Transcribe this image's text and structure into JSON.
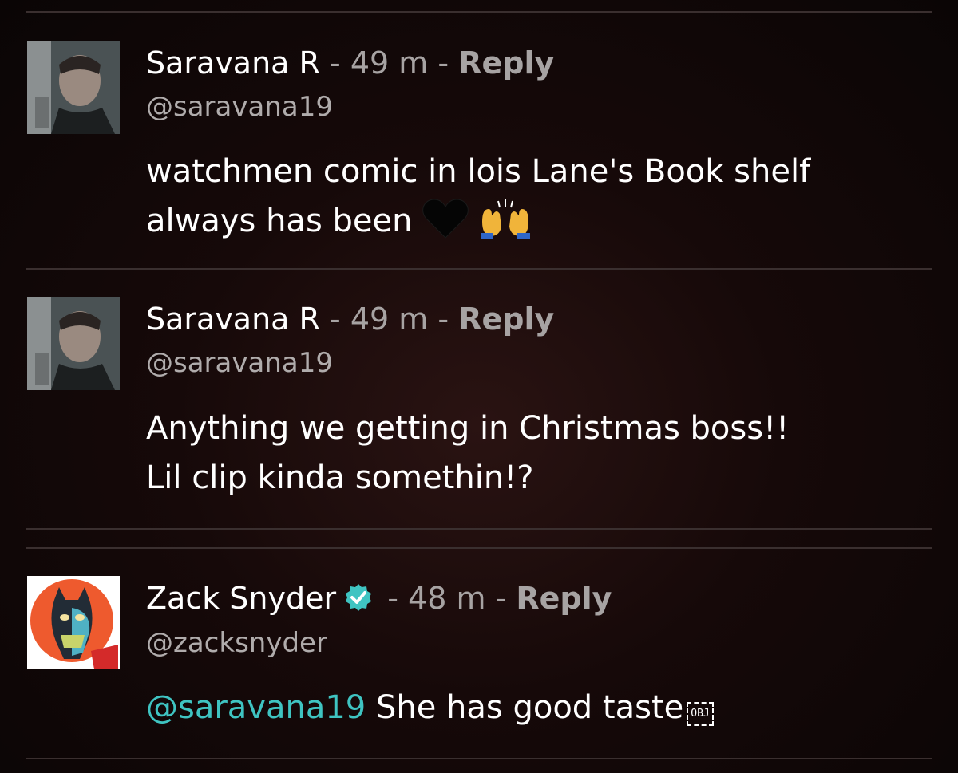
{
  "comments": [
    {
      "author": "Saravana R",
      "separator": "-",
      "time": "49 m",
      "reply_label": "Reply",
      "handle": "@saravana19",
      "text_line1": "watchmen comic in lois Lane's Book shelf",
      "text_line2": "always has been",
      "emojis": [
        "black-heart",
        "raising-hands"
      ]
    },
    {
      "author": "Saravana R",
      "separator": "-",
      "time": "49 m",
      "reply_label": "Reply",
      "handle": "@saravana19",
      "text_line1": "Anything we getting in Christmas boss!!",
      "text_line2": "Lil clip kinda somethin!?"
    },
    {
      "author": "Zack Snyder",
      "verified": true,
      "separator": "-",
      "time": "48 m",
      "reply_label": "Reply",
      "handle": "@zacksnyder",
      "mention": "@saravana19",
      "text": "She has good taste",
      "object_placeholder": "OBJ"
    }
  ],
  "colors": {
    "mention": "#3fc4c2",
    "verified_badge": "#3fc4c2",
    "meta_text": "#a7a3a3"
  }
}
